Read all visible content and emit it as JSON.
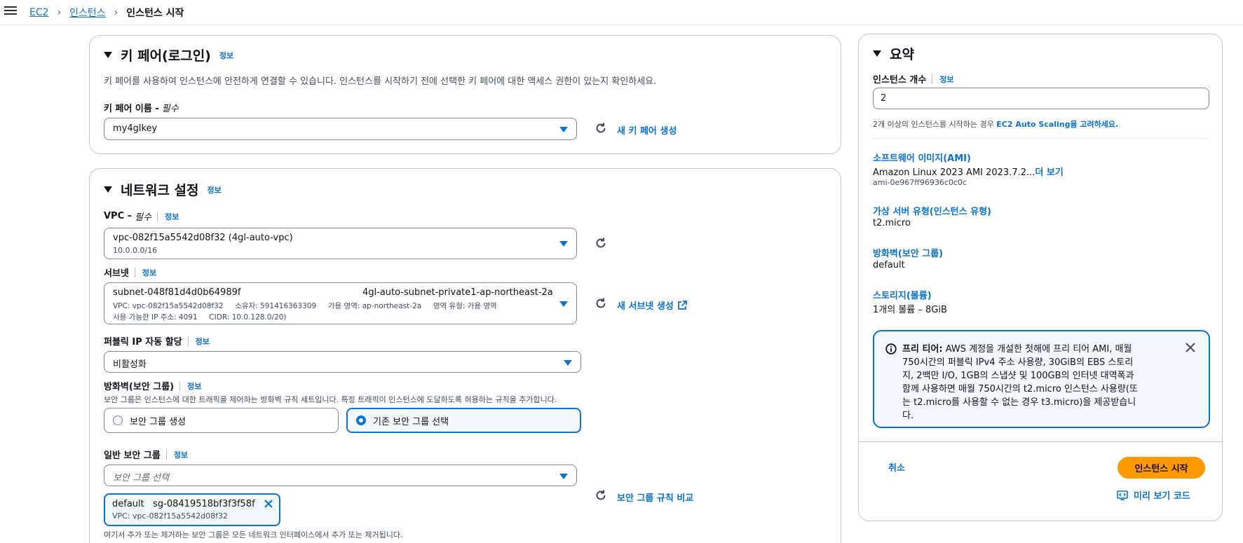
{
  "breadcrumb": {
    "item1": "EC2",
    "item2": "인스턴스",
    "current": "인스턴스 시작"
  },
  "keypair": {
    "title": "키 페어(로그인)",
    "info": "정보",
    "description": "키 페어를 사용하여 인스턴스에 안전하게 연결할 수 있습니다. 인스턴스를 시작하기 전에 선택한 키 페어에 대한 액세스 권한이 있는지 확인하세요.",
    "name_label": "키 페어 이름 - ",
    "name_required": "필수",
    "selected": "my4glkey",
    "create_link": "새 키 페어 생성"
  },
  "network": {
    "title": "네트워크 설정",
    "info": "정보",
    "vpc": {
      "label": "VPC – ",
      "required": "필수",
      "info": "정보",
      "value": "vpc-082f15a5542d08f32 (4gl-auto-vpc)",
      "cidr": "10.0.0.0/16"
    },
    "subnet": {
      "label": "서브넷",
      "info": "정보",
      "id": "subnet-048f81d4d0b64989f",
      "name": "4gl-auto-subnet-private1-ap-northeast-2a",
      "details1": "VPC: vpc-082f15a5542d08f32     소유자: 591416363309     가용 영역: ap-northeast-2a     영역 유형: 가용 영역",
      "details2": "사용 가능한 IP 주소: 4091     CIDR: 10.0.128.0/20)",
      "create_link": "새 서브넷 생성"
    },
    "public_ip": {
      "label": "퍼블릭 IP 자동 할당",
      "info": "정보",
      "value": "비활성화"
    },
    "firewall": {
      "label": "방화벽(보안 그룹)",
      "info": "정보",
      "description": "보안 그룹은 인스턴스에 대한 트래픽을 제어하는 방화벽 규칙 세트입니다. 특정 트래픽이 인스턴스에 도달하도록 허용하는 규칙을 추가합니다.",
      "option_create": "보안 그룹 생성",
      "option_existing": "기존 보안 그룹 선택"
    },
    "common_sg": {
      "label": "일반 보안 그룹",
      "info": "정보",
      "placeholder": "보안 그룹 선택",
      "compare_link": "보안 그룹 규칙 비교",
      "token_name": "default   sg-08419518bf3f3f58f",
      "token_sub": "VPC: vpc-082f15a5542d08f32",
      "footnote": "여기서 추가 또는 제거하는 보안 그룹은 모든 네트워크 인터페이스에서 추가 또는 제거됩니다."
    }
  },
  "summary": {
    "title": "요약",
    "instance_count_label": "인스턴스 개수",
    "info": "정보",
    "instance_count": "2",
    "hint_prefix": "2개 이상의 인스턴스를 시작하는 경우 ",
    "hint_link": "EC2 Auto Scaling을 고려하세요.",
    "ami_label": "소프트웨어 이미지(AMI)",
    "ami_value": "Amazon Linux 2023 AMI 2023.7.2...",
    "ami_more": "더 보기",
    "ami_id": "ami-0e967ff96936c0c0c",
    "type_label": "가상 서버 유형(인스턴스 유형)",
    "type_value": "t2.micro",
    "firewall_label": "방화벽(보안 그룹)",
    "firewall_value": "default",
    "storage_label": "스토리지(볼륨)",
    "storage_value": "1개의 볼륨 – 8GiB",
    "free_tier_bold": "프리 티어:",
    "free_tier_text": " AWS 계정을 개설한 첫해에 프리 티어 AMI, 매월 750시간의 퍼블릭 IPv4 주소 사용량, 30GiB의 EBS 스토리지, 2백만 I/O, 1GB의 스냅샷 및 100GB의 인터넷 대역폭과 함께 사용하면 매월 750시간의 t2.micro 인스턴스 사용량(또는 t2.micro를 사용할 수 없는 경우 t3.micro)을 제공받습니다.",
    "cancel": "취소",
    "launch": "인스턴스 시작",
    "preview_code": "미리 보기 코드"
  }
}
